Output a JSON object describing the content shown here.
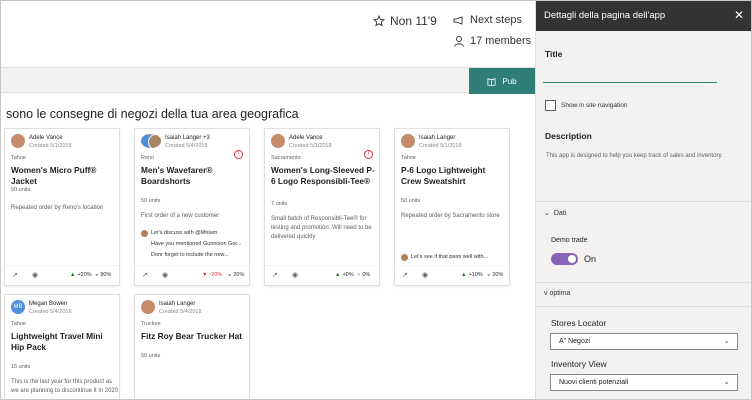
{
  "header": {
    "follow_label": "Non 11'9",
    "next_steps_label": "Next steps",
    "members_label": "17 members"
  },
  "command_bar": {
    "publish_label": "Pub"
  },
  "section_title": "sono le consegne di negozi della tua area geografica",
  "cards": [
    {
      "author": "Adele Vance",
      "date": "Created 5/1/2018",
      "location": "Tahoe",
      "title": "Women's Micro Puff® Jacket",
      "units": "50 units",
      "description": "Repeated order by Reno's location",
      "stat_change": "+20%",
      "stat_percent": "80%"
    },
    {
      "author": "Isaiah Langer +3",
      "date": "Created 5/4/2018",
      "location": "Reno",
      "title": "Men's Wavefarer® Boardshorts",
      "units": "50 units",
      "description": "First order of a new customer",
      "comments": [
        "Let's discuss with @Miriam",
        "Have you mentioned Gunnison Gor...",
        "Donr forget to include the new..."
      ],
      "stat_change": "-20%",
      "stat_percent": "20%"
    },
    {
      "author": "Adele Vance",
      "date": "Created 5/1/2018",
      "location": "Sacramento",
      "title": "Women's Long-Sleeved P-6 Logo Responsibli-Tee®",
      "units": "7 units",
      "description": "Small batch of Responsibli-Tee® for testing and promotion. Will need to be delivered quickly",
      "stat_change": "+0%",
      "stat_percent": "0%"
    },
    {
      "author": "Isaiah Langer",
      "date": "Created 5/1/2018",
      "location": "Tahoe",
      "title": "P-6 Logo Lightweight Crew Sweatshirt",
      "units": "50 units",
      "description": "Repeated order by Sacramento store",
      "comments": [
        "Let's see if that pairs well with..."
      ],
      "stat_change": "+10%",
      "stat_percent": "20%"
    },
    {
      "author": "Megan Bowen",
      "date": "Created 5/4/2018",
      "location": "Tahoe",
      "title": "Lightweight Travel Mini Hip Pack",
      "units": "15 units",
      "description": "This is the last year for this product as we are planning to discontinue it in 2020"
    },
    {
      "author": "Isaiah Langer",
      "date": "Created 5/4/2018",
      "location": "Truckee",
      "title": "Fitz Roy Bear Trucker Hat",
      "units": "50 units"
    }
  ],
  "panel": {
    "title": "Dettagli della pagina dell'app",
    "title_field_label": "Title",
    "show_in_nav_label": "Show in site navigation",
    "description_label": "Description",
    "description_text": "This app is designed to help you keep track of sales and inventory.",
    "group_dati": "Dati",
    "demo_trade_label": "Demo trade",
    "toggle_state": "On",
    "group_optima": "v optima",
    "stores_locator_label": "Stores Locator",
    "stores_locator_value": "A\" Negozi",
    "inventory_view_label": "Inventory View",
    "inventory_view_value": "Nuovi clienti potenziali"
  },
  "colors": {
    "accent": "#2f7d77",
    "toggle": "#8764b8",
    "panel_header": "#333333"
  }
}
